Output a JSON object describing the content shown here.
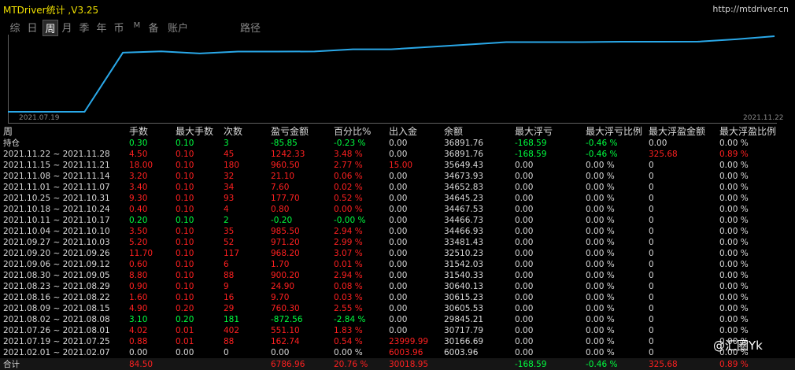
{
  "app": {
    "title": "MTDriver统计 ,V3.25",
    "site": "http://mtdriver.cn"
  },
  "tabs": [
    "综",
    "日",
    "周",
    "月",
    "季",
    "年",
    "币",
    "M",
    "备",
    "账户",
    "路径"
  ],
  "active_tab": "周",
  "chart": {
    "start_label": "2021.07.19",
    "end_label": "2021.11.22",
    "line_color": "#2aa8e8",
    "points": [
      6003.96,
      6003.96,
      6003.96,
      30166.69,
      30717.79,
      29845.21,
      30605.53,
      30615.23,
      30640.13,
      31540.33,
      31542.03,
      32510.23,
      33481.43,
      34466.93,
      34466.73,
      34467.53,
      34645.23,
      34652.83,
      34673.93,
      35649.43,
      36891.76
    ]
  },
  "columns": [
    "周",
    "手数",
    "最大手数",
    "次数",
    "盈亏金额",
    "百分比%",
    "出入金",
    "余额",
    "最大浮亏",
    "最大浮亏比例",
    "最大浮盈金额",
    "最大浮盈比例"
  ],
  "rows": [
    {
      "c": [
        "持仓",
        "0.30",
        "0.10",
        "3",
        "-85.85",
        "-0.23 %",
        "0.00",
        "36891.76",
        "-168.59",
        "-0.46 %",
        "0.00",
        "0.00 %"
      ],
      "col": [
        "w",
        "g",
        "g",
        "g",
        "g",
        "g",
        "w",
        "w",
        "g",
        "g",
        "w",
        "w"
      ]
    },
    {
      "c": [
        "2021.11.22 ~ 2021.11.28",
        "4.50",
        "0.10",
        "45",
        "1242.33",
        "3.48 %",
        "0.00",
        "36891.76",
        "-168.59",
        "-0.46 %",
        "325.68",
        "0.89 %"
      ],
      "col": [
        "w",
        "r",
        "r",
        "r",
        "r",
        "r",
        "w",
        "w",
        "g",
        "g",
        "r",
        "r"
      ]
    },
    {
      "c": [
        "2021.11.15 ~ 2021.11.21",
        "18.00",
        "0.10",
        "180",
        "960.50",
        "2.77 %",
        "15.00",
        "35649.43",
        "0.00",
        "0.00 %",
        "0",
        "0.00 %"
      ],
      "col": [
        "w",
        "r",
        "r",
        "r",
        "r",
        "r",
        "r",
        "w",
        "w",
        "w",
        "w",
        "w"
      ]
    },
    {
      "c": [
        "2021.11.08 ~ 2021.11.14",
        "3.20",
        "0.10",
        "32",
        "21.10",
        "0.06 %",
        "0.00",
        "34673.93",
        "0.00",
        "0.00 %",
        "0",
        "0.00 %"
      ],
      "col": [
        "w",
        "r",
        "r",
        "r",
        "r",
        "r",
        "w",
        "w",
        "w",
        "w",
        "w",
        "w"
      ]
    },
    {
      "c": [
        "2021.11.01 ~ 2021.11.07",
        "3.40",
        "0.10",
        "34",
        "7.60",
        "0.02 %",
        "0.00",
        "34652.83",
        "0.00",
        "0.00 %",
        "0",
        "0.00 %"
      ],
      "col": [
        "w",
        "r",
        "r",
        "r",
        "r",
        "r",
        "w",
        "w",
        "w",
        "w",
        "w",
        "w"
      ]
    },
    {
      "c": [
        "2021.10.25 ~ 2021.10.31",
        "9.30",
        "0.10",
        "93",
        "177.70",
        "0.52 %",
        "0.00",
        "34645.23",
        "0.00",
        "0.00 %",
        "0",
        "0.00 %"
      ],
      "col": [
        "w",
        "r",
        "r",
        "r",
        "r",
        "r",
        "w",
        "w",
        "w",
        "w",
        "w",
        "w"
      ]
    },
    {
      "c": [
        "2021.10.18 ~ 2021.10.24",
        "0.40",
        "0.10",
        "4",
        "0.80",
        "0.00 %",
        "0.00",
        "34467.53",
        "0.00",
        "0.00 %",
        "0",
        "0.00 %"
      ],
      "col": [
        "w",
        "r",
        "r",
        "r",
        "r",
        "r",
        "w",
        "w",
        "w",
        "w",
        "w",
        "w"
      ]
    },
    {
      "c": [
        "2021.10.11 ~ 2021.10.17",
        "0.20",
        "0.10",
        "2",
        "-0.20",
        "-0.00 %",
        "0.00",
        "34466.73",
        "0.00",
        "0.00 %",
        "0",
        "0.00 %"
      ],
      "col": [
        "w",
        "g",
        "g",
        "g",
        "g",
        "g",
        "w",
        "w",
        "w",
        "w",
        "w",
        "w"
      ]
    },
    {
      "c": [
        "2021.10.04 ~ 2021.10.10",
        "3.50",
        "0.10",
        "35",
        "985.50",
        "2.94 %",
        "0.00",
        "34466.93",
        "0.00",
        "0.00 %",
        "0",
        "0.00 %"
      ],
      "col": [
        "w",
        "r",
        "r",
        "r",
        "r",
        "r",
        "w",
        "w",
        "w",
        "w",
        "w",
        "w"
      ]
    },
    {
      "c": [
        "2021.09.27 ~ 2021.10.03",
        "5.20",
        "0.10",
        "52",
        "971.20",
        "2.99 %",
        "0.00",
        "33481.43",
        "0.00",
        "0.00 %",
        "0",
        "0.00 %"
      ],
      "col": [
        "w",
        "r",
        "r",
        "r",
        "r",
        "r",
        "w",
        "w",
        "w",
        "w",
        "w",
        "w"
      ]
    },
    {
      "c": [
        "2021.09.20 ~ 2021.09.26",
        "11.70",
        "0.10",
        "117",
        "968.20",
        "3.07 %",
        "0.00",
        "32510.23",
        "0.00",
        "0.00 %",
        "0",
        "0.00 %"
      ],
      "col": [
        "w",
        "r",
        "r",
        "r",
        "r",
        "r",
        "w",
        "w",
        "w",
        "w",
        "w",
        "w"
      ]
    },
    {
      "c": [
        "2021.09.06 ~ 2021.09.12",
        "0.60",
        "0.10",
        "6",
        "1.70",
        "0.01 %",
        "0.00",
        "31542.03",
        "0.00",
        "0.00 %",
        "0",
        "0.00 %"
      ],
      "col": [
        "w",
        "r",
        "r",
        "r",
        "r",
        "r",
        "w",
        "w",
        "w",
        "w",
        "w",
        "w"
      ]
    },
    {
      "c": [
        "2021.08.30 ~ 2021.09.05",
        "8.80",
        "0.10",
        "88",
        "900.20",
        "2.94 %",
        "0.00",
        "31540.33",
        "0.00",
        "0.00 %",
        "0",
        "0.00 %"
      ],
      "col": [
        "w",
        "r",
        "r",
        "r",
        "r",
        "r",
        "w",
        "w",
        "w",
        "w",
        "w",
        "w"
      ]
    },
    {
      "c": [
        "2021.08.23 ~ 2021.08.29",
        "0.90",
        "0.10",
        "9",
        "24.90",
        "0.08 %",
        "0.00",
        "30640.13",
        "0.00",
        "0.00 %",
        "0",
        "0.00 %"
      ],
      "col": [
        "w",
        "r",
        "r",
        "r",
        "r",
        "r",
        "w",
        "w",
        "w",
        "w",
        "w",
        "w"
      ]
    },
    {
      "c": [
        "2021.08.16 ~ 2021.08.22",
        "1.60",
        "0.10",
        "16",
        "9.70",
        "0.03 %",
        "0.00",
        "30615.23",
        "0.00",
        "0.00 %",
        "0",
        "0.00 %"
      ],
      "col": [
        "w",
        "r",
        "r",
        "r",
        "r",
        "r",
        "w",
        "w",
        "w",
        "w",
        "w",
        "w"
      ]
    },
    {
      "c": [
        "2021.08.09 ~ 2021.08.15",
        "4.90",
        "0.20",
        "29",
        "760.30",
        "2.55 %",
        "0.00",
        "30605.53",
        "0.00",
        "0.00 %",
        "0",
        "0.00 %"
      ],
      "col": [
        "w",
        "r",
        "r",
        "r",
        "r",
        "r",
        "w",
        "w",
        "w",
        "w",
        "w",
        "w"
      ]
    },
    {
      "c": [
        "2021.08.02 ~ 2021.08.08",
        "3.10",
        "0.20",
        "181",
        "-872.56",
        "-2.84 %",
        "0.00",
        "29845.21",
        "0.00",
        "0.00 %",
        "0",
        "0.00 %"
      ],
      "col": [
        "w",
        "g",
        "g",
        "g",
        "g",
        "g",
        "w",
        "w",
        "w",
        "w",
        "w",
        "w"
      ]
    },
    {
      "c": [
        "2021.07.26 ~ 2021.08.01",
        "4.02",
        "0.01",
        "402",
        "551.10",
        "1.83 %",
        "0.00",
        "30717.79",
        "0.00",
        "0.00 %",
        "0",
        "0.00 %"
      ],
      "col": [
        "w",
        "r",
        "r",
        "r",
        "r",
        "r",
        "w",
        "w",
        "w",
        "w",
        "w",
        "w"
      ]
    },
    {
      "c": [
        "2021.07.19 ~ 2021.07.25",
        "0.88",
        "0.01",
        "88",
        "162.74",
        "0.54 %",
        "23999.99",
        "30166.69",
        "0.00",
        "0.00 %",
        "0",
        "0.00 %"
      ],
      "col": [
        "w",
        "r",
        "r",
        "r",
        "r",
        "r",
        "r",
        "w",
        "w",
        "w",
        "w",
        "w"
      ]
    },
    {
      "c": [
        "2021.02.01 ~ 2021.02.07",
        "0.00",
        "0.00",
        "0",
        "0.00",
        "0.00 %",
        "6003.96",
        "6003.96",
        "0.00",
        "0.00 %",
        "0",
        "0.00 %"
      ],
      "col": [
        "w",
        "w",
        "w",
        "w",
        "w",
        "w",
        "r",
        "w",
        "w",
        "w",
        "w",
        "w"
      ]
    }
  ],
  "total": {
    "c": [
      "合计",
      "84.50",
      "",
      "",
      "6786.96",
      "20.76 %",
      "30018.95",
      "",
      "-168.59",
      "-0.46 %",
      "325.68",
      "0.89 %"
    ],
    "col": [
      "w",
      "r",
      "w",
      "w",
      "r",
      "r",
      "r",
      "w",
      "g",
      "g",
      "r",
      "r"
    ]
  },
  "watermark": "@汇圈Yk"
}
